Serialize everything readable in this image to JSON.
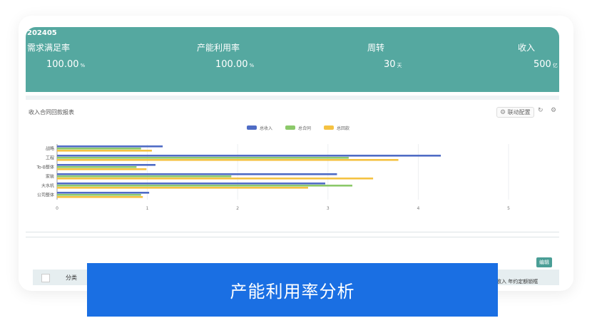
{
  "kpi": {
    "period": "202405",
    "items": [
      {
        "label": "需求满足率",
        "value": "100.00",
        "unit": "%"
      },
      {
        "label": "产能利用率",
        "value": "100.00",
        "unit": "%"
      },
      {
        "label": "周转",
        "value": "30",
        "unit": "天"
      },
      {
        "label": "收入",
        "value": "500",
        "unit": "亿"
      }
    ]
  },
  "chart_section": {
    "title": "收入合同回款报表",
    "link_config_label": "联动配置"
  },
  "chart_data": {
    "type": "bar",
    "orientation": "horizontal",
    "categories": [
      "战略",
      "工程",
      "To-B整体",
      "家装",
      "大水机",
      "公司整体"
    ],
    "series": [
      {
        "name": "总收入",
        "color": "#4f6cc5",
        "values": [
          1.17,
          4.25,
          1.09,
          3.1,
          2.97,
          1.02
        ]
      },
      {
        "name": "总合同",
        "color": "#8cc96a",
        "values": [
          0.93,
          3.23,
          0.88,
          1.93,
          3.27,
          0.93
        ]
      },
      {
        "name": "总回款",
        "color": "#f5c242",
        "values": [
          1.05,
          3.78,
          0.99,
          3.5,
          2.78,
          0.95
        ]
      }
    ],
    "xticks": [
      "0",
      "1",
      "2",
      "3",
      "4",
      "5"
    ],
    "xlim": [
      0,
      5
    ],
    "legend_position": "top-center",
    "grid": true
  },
  "table": {
    "edit_label": "编辑",
    "headers": [
      "分类",
      "收入 年约定额锁框"
    ]
  },
  "banner": {
    "text": "产能利用率分析"
  }
}
